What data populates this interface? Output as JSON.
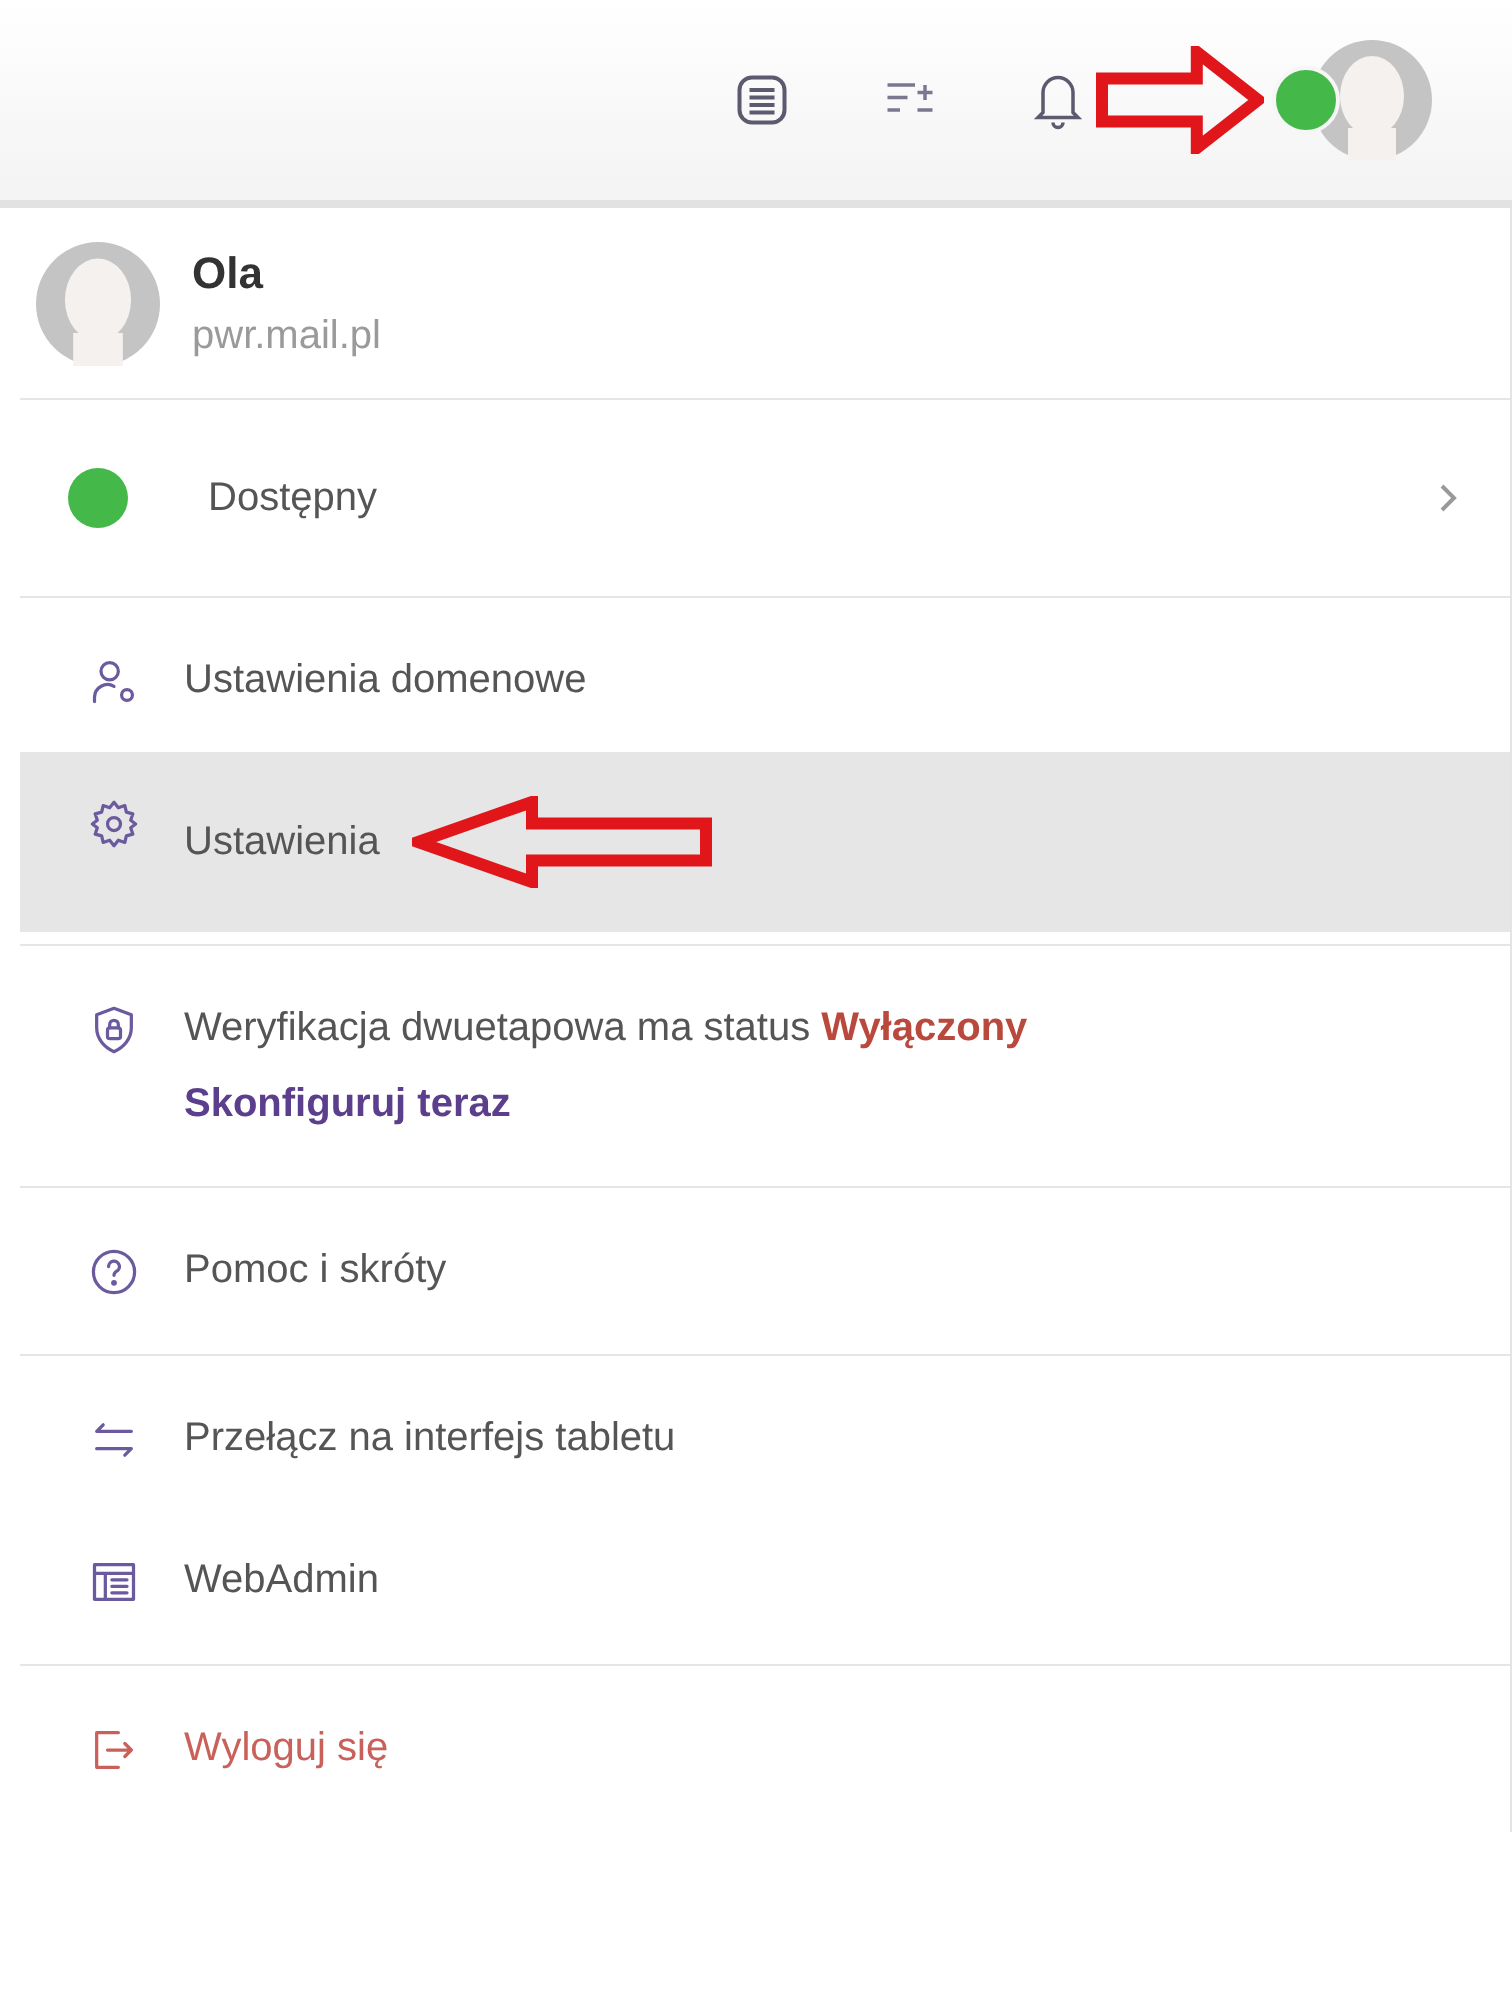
{
  "user": {
    "name": "Ola",
    "domain": "pwr.mail.pl",
    "color": "#45b84a"
  },
  "status": {
    "label": "Dostępny",
    "color": "#45b84a"
  },
  "groups": [
    {
      "items": [
        {
          "kind": "domain",
          "label": "Ustawienia domenowe",
          "selected": false
        },
        {
          "kind": "settings",
          "label": "Ustawienia",
          "selected": true
        }
      ]
    },
    {
      "items": [
        {
          "kind": "security",
          "label": "Weryfikacja dwuetapowa ma status",
          "state": "Wyłączony",
          "action": "Skonfiguruj teraz",
          "selected": false
        }
      ]
    },
    {
      "items": [
        {
          "kind": "help",
          "label": "Pomoc i skróty",
          "selected": false
        }
      ]
    },
    {
      "items": [
        {
          "kind": "switch",
          "label": "Przełącz na interfejs tabletu",
          "selected": false
        },
        {
          "kind": "admin",
          "label": "WebAdmin",
          "selected": false
        }
      ]
    },
    {
      "items": [
        {
          "kind": "logout",
          "label": "Wyloguj się",
          "selected": false
        }
      ]
    }
  ]
}
